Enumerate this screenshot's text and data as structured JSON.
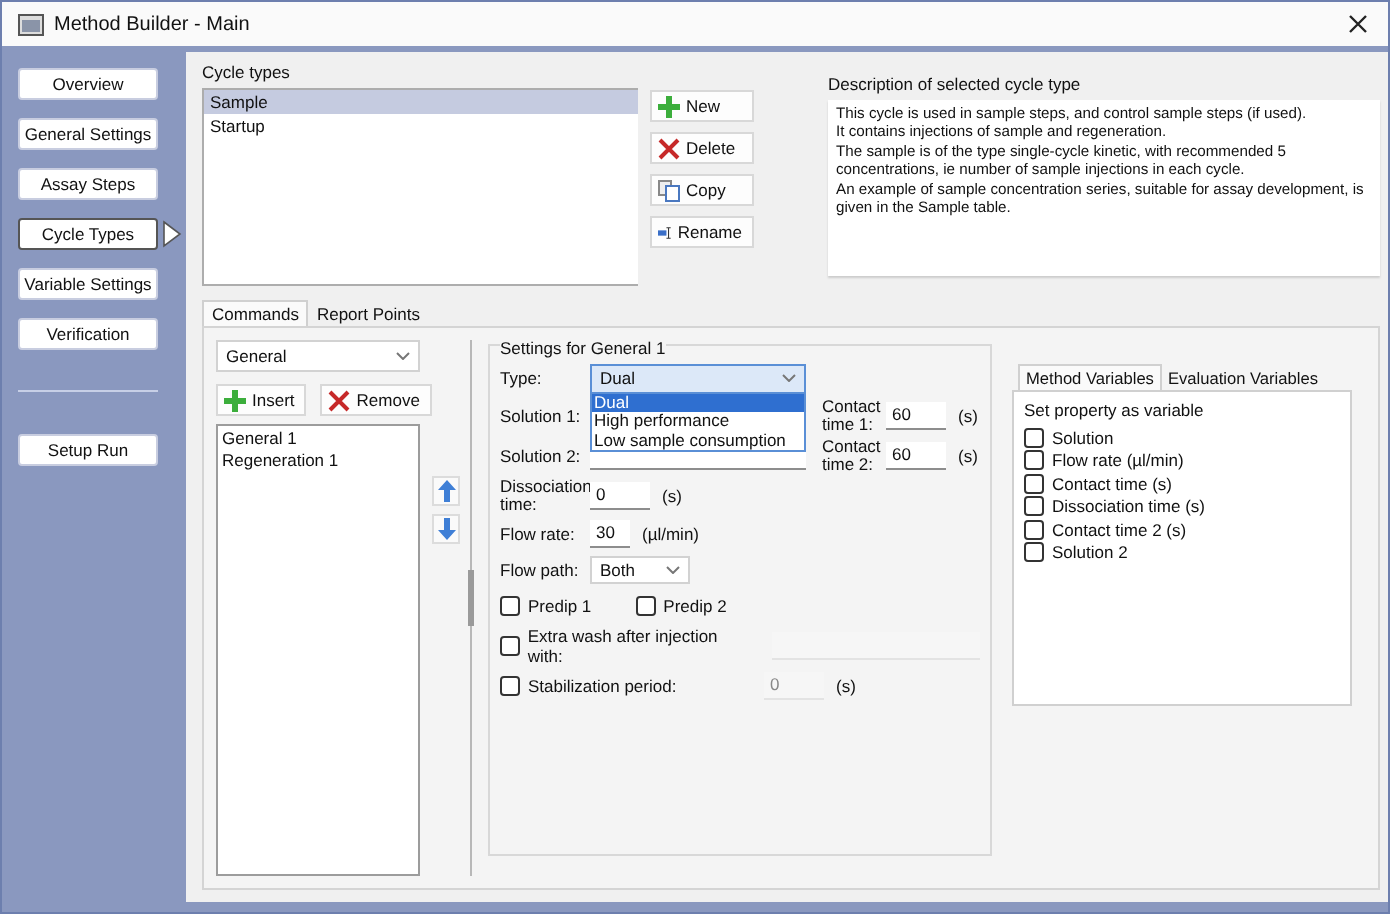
{
  "window": {
    "title": "Method Builder - Main"
  },
  "sidebar": {
    "items": [
      {
        "label": "Overview",
        "selected": false
      },
      {
        "label": "General Settings",
        "selected": false
      },
      {
        "label": "Assay Steps",
        "selected": false
      },
      {
        "label": "Cycle Types",
        "selected": true
      },
      {
        "label": "Variable Settings",
        "selected": false
      },
      {
        "label": "Verification",
        "selected": false
      }
    ],
    "run_button": "Setup Run"
  },
  "cycle_types": {
    "label": "Cycle types",
    "items": [
      {
        "label": "Sample",
        "selected": true
      },
      {
        "label": "Startup",
        "selected": false
      }
    ],
    "buttons": [
      {
        "label": "New",
        "kind": "new"
      },
      {
        "label": "Delete",
        "kind": "delete"
      },
      {
        "label": "Copy",
        "kind": "copy"
      },
      {
        "label": "Rename",
        "kind": "rename"
      }
    ]
  },
  "description": {
    "label": "Description of selected cycle type",
    "paragraphs": [
      "This cycle is used in sample steps, and control sample steps (if used).",
      "It contains injections of sample and regeneration.",
      "The sample is of the type single-cycle kinetic, with recommended 5 concentrations, ie number of sample injections in each cycle.",
      "An example of sample concentration series, suitable for assay development, is given in the Sample table."
    ]
  },
  "tabs": [
    {
      "label": "Commands",
      "selected": true
    },
    {
      "label": "Report Points",
      "selected": false
    }
  ],
  "commands": {
    "category": "General",
    "buttons": [
      {
        "label": "Insert",
        "kind": "new"
      },
      {
        "label": "Remove",
        "kind": "delete"
      }
    ],
    "items": [
      {
        "label": "General 1"
      },
      {
        "label": "Regeneration 1"
      }
    ]
  },
  "settings": {
    "title": "Settings for General 1",
    "type": {
      "label": "Type:",
      "value": "Dual",
      "options": [
        {
          "label": "Dual",
          "selected": true
        },
        {
          "label": "High performance",
          "selected": false
        },
        {
          "label": "Low sample consumption",
          "selected": false
        }
      ]
    },
    "solution_1": {
      "label": "Solution 1:"
    },
    "solution_2": {
      "label": "Solution 2:"
    },
    "contact_time_1": {
      "label": "Contact time 1:",
      "value": "60",
      "unit": "(s)"
    },
    "contact_time_2": {
      "label": "Contact time 2:",
      "value": "60",
      "unit": "(s)"
    },
    "dissociation_time": {
      "label": "Dissociation time:",
      "value": "0",
      "unit": "(s)"
    },
    "flow_rate": {
      "label": "Flow rate:",
      "value": "30",
      "unit": "(µl/min)"
    },
    "flow_path": {
      "label": "Flow path:",
      "value": "Both"
    },
    "predips": [
      {
        "label": "Predip 1",
        "checked": false
      },
      {
        "label": "Predip 2",
        "checked": false
      }
    ],
    "extra_wash": {
      "label": "Extra wash after injection with:",
      "checked": false
    },
    "stabilization": {
      "label": "Stabilization period:",
      "checked": false,
      "value": "0",
      "unit": "(s)"
    }
  },
  "variables": {
    "tabs": [
      {
        "label": "Method Variables",
        "selected": true
      },
      {
        "label": "Evaluation Variables",
        "selected": false
      }
    ],
    "heading": "Set property as variable",
    "items": [
      {
        "label": "Solution",
        "checked": false
      },
      {
        "label": "Flow rate (µl/min)",
        "checked": false
      },
      {
        "label": "Contact time (s)",
        "checked": false
      },
      {
        "label": "Dissociation time (s)",
        "checked": false
      },
      {
        "label": "Contact time 2 (s)",
        "checked": false
      },
      {
        "label": "Solution 2",
        "checked": false
      }
    ]
  }
}
